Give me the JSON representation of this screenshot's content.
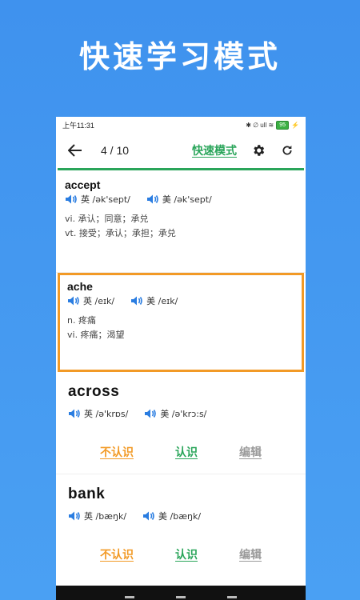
{
  "promo": {
    "title": "快速学习模式"
  },
  "status": {
    "time": "上午11:31",
    "icons": "✱ ∅ ull ≋",
    "battery": "95",
    "charge": "⚡"
  },
  "appbar": {
    "counter": "4 / 10",
    "mode_label": "快速模式"
  },
  "cards": [
    {
      "word": "accept",
      "uk_label": "英 /ək'sept/",
      "us_label": "美 /ək'sept/",
      "meanings": [
        "vi. 承认；同意；承兑",
        "vt. 接受；承认；承担；承兑"
      ]
    },
    {
      "word": "ache",
      "uk_label": "英 /eɪk/",
      "us_label": "美 /eɪk/",
      "meanings": [
        "n. 疼痛",
        "vi. 疼痛；渴望"
      ]
    },
    {
      "word": "across",
      "uk_label": "英 /ə'krɒs/",
      "us_label": "美 /ə'krɔ:s/",
      "actions": {
        "unknown": "不认识",
        "known": "认识",
        "edit": "编辑"
      }
    },
    {
      "word": "bank",
      "uk_label": "英 /bæŋk/",
      "us_label": "美 /bæŋk/",
      "actions": {
        "unknown": "不认识",
        "known": "认识",
        "edit": "编辑"
      }
    }
  ],
  "colors": {
    "accent_green": "#2aa55a",
    "accent_orange": "#f29a26",
    "background_blue": "#4aa0f3"
  }
}
